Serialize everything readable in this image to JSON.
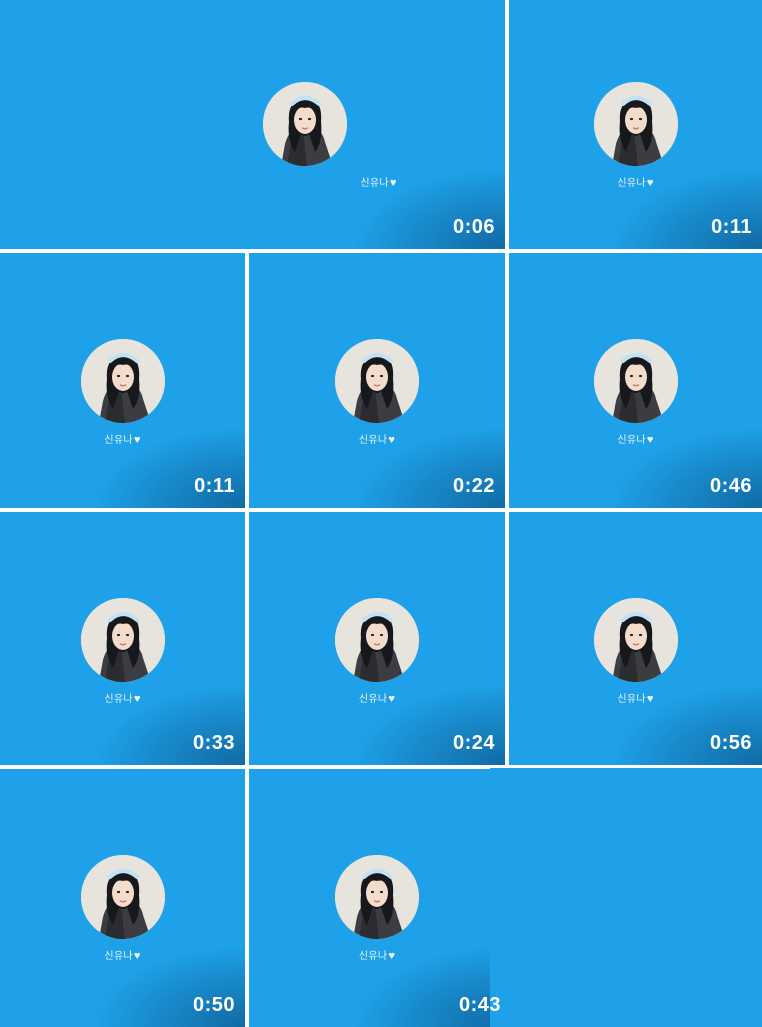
{
  "colors": {
    "tile_background": "#1ea1e9",
    "gutter": "#ffffff",
    "text": "#ffffff"
  },
  "items": [
    {
      "name": "신유나",
      "icon": "heart-icon",
      "duration": "0:06"
    },
    {
      "name": "신유나",
      "icon": "heart-icon",
      "duration": "0:11"
    },
    {
      "name": "신유나",
      "icon": "heart-icon",
      "duration": "0:11"
    },
    {
      "name": "신유나",
      "icon": "heart-icon",
      "duration": "0:22"
    },
    {
      "name": "신유나",
      "icon": "heart-icon",
      "duration": "0:46"
    },
    {
      "name": "신유나",
      "icon": "heart-icon",
      "duration": "0:33"
    },
    {
      "name": "신유나",
      "icon": "heart-icon",
      "duration": "0:24"
    },
    {
      "name": "신유나",
      "icon": "heart-icon",
      "duration": "0:56"
    },
    {
      "name": "신유나",
      "icon": "heart-icon",
      "duration": "0:50"
    },
    {
      "name": "신유나",
      "icon": "heart-icon",
      "duration": "0:43"
    }
  ]
}
